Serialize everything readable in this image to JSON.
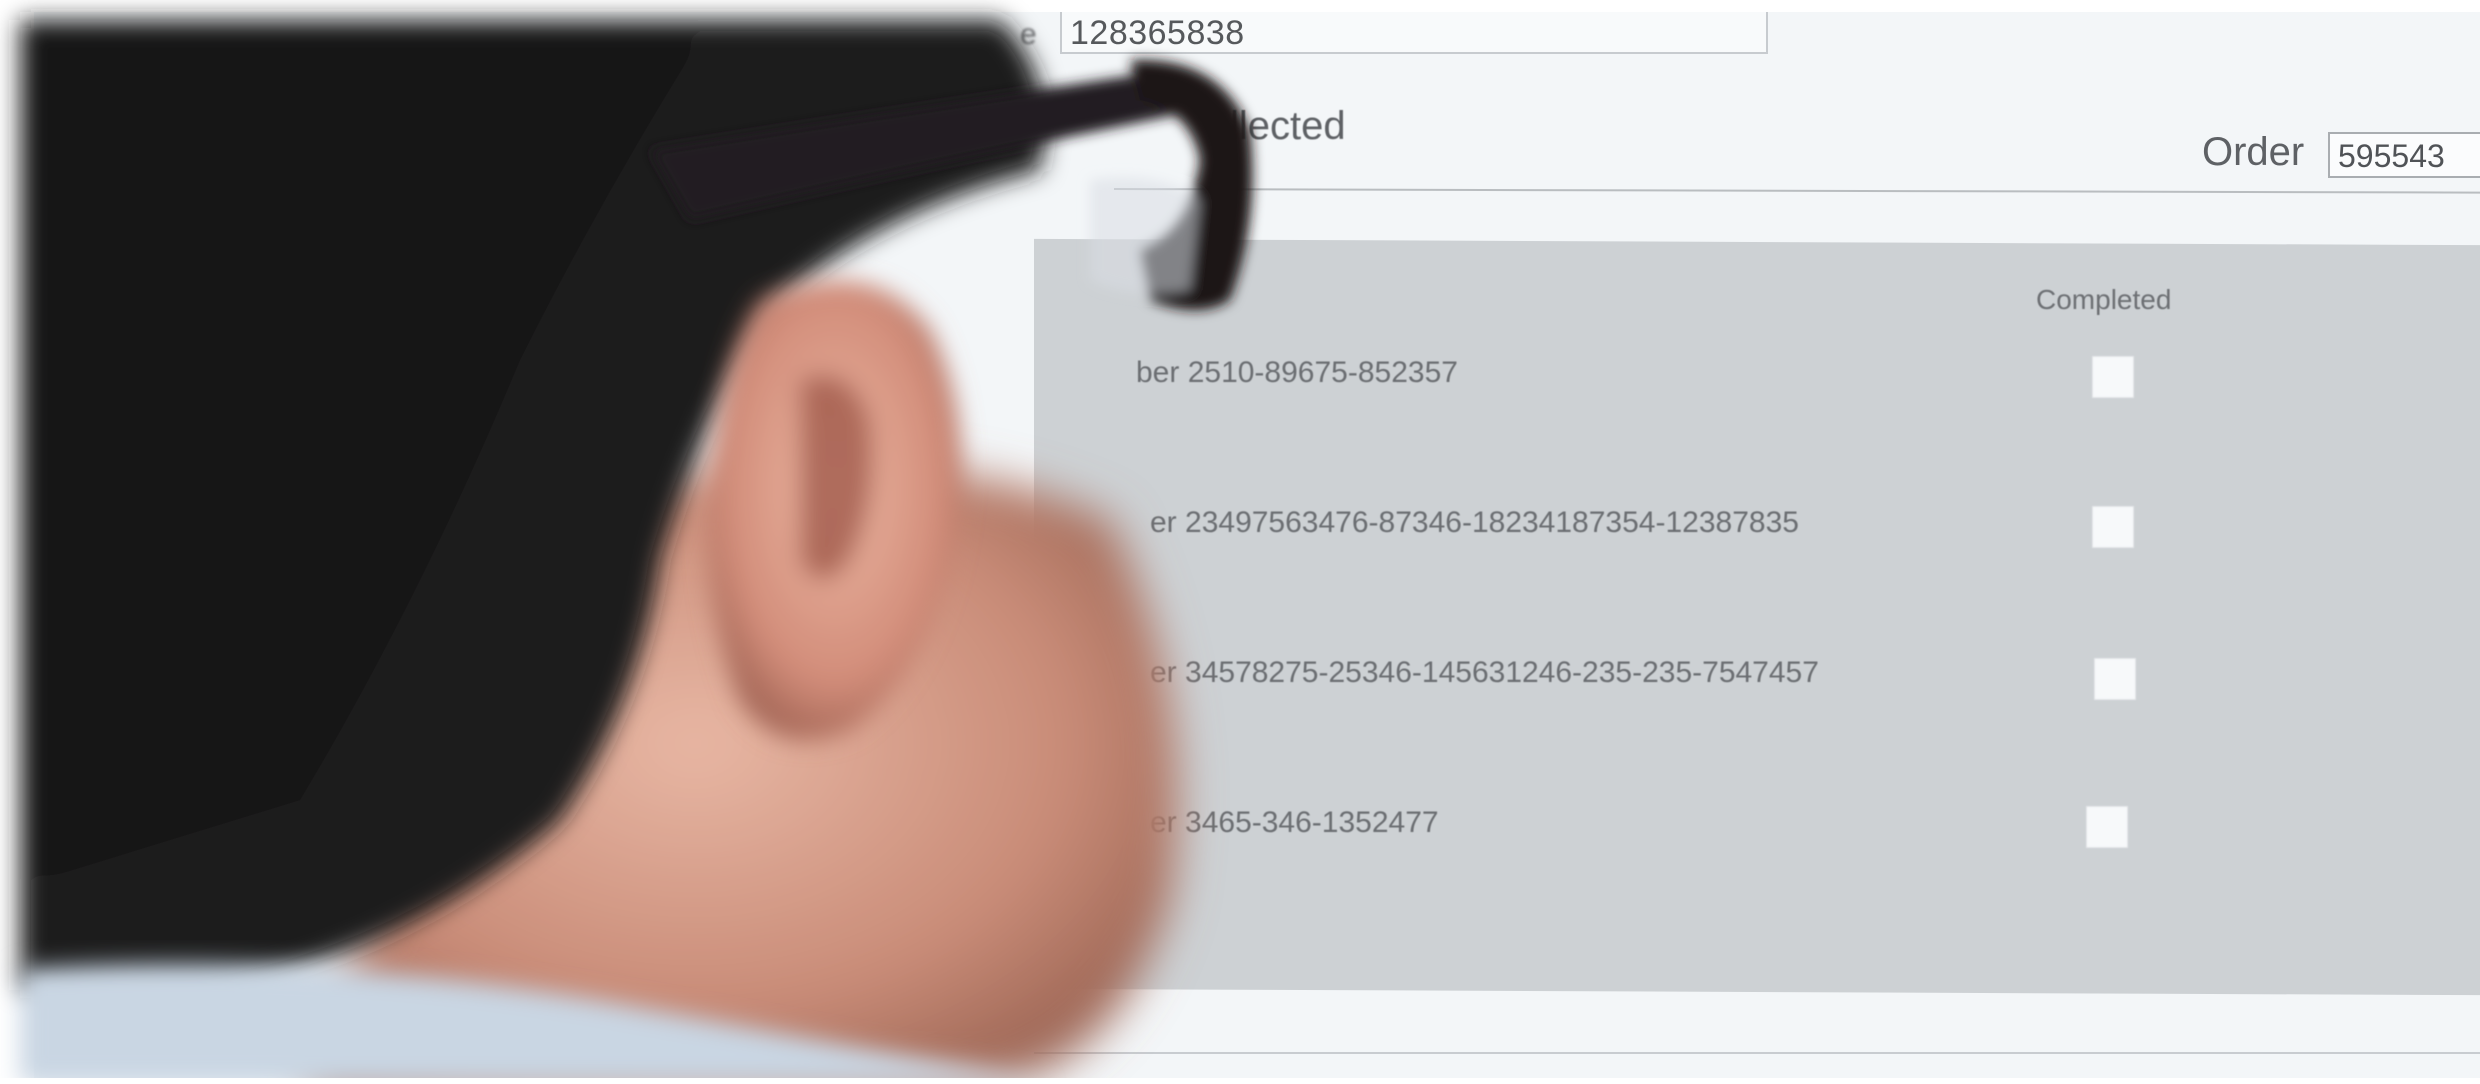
{
  "form": {
    "top_field_value": "128365838",
    "top_field_label_partial": "e",
    "section_title_partial": "llected",
    "order_label": "Order",
    "order_value": "595543",
    "completed_header": "Completed"
  },
  "rows": [
    {
      "label": "ber  2510-89675-852357",
      "checked": false
    },
    {
      "label": "er 23497563476-87346-18234187354-12387835",
      "checked": false
    },
    {
      "label": "er 34578275-25346-145631246-235-235-7547457",
      "checked": false
    },
    {
      "label": "er 3465-346-1352477",
      "checked": false
    }
  ],
  "colors": {
    "screen_bg": "#f3f6f8",
    "panel_bg": "#cdd1d4",
    "text": "#6b6e72"
  }
}
